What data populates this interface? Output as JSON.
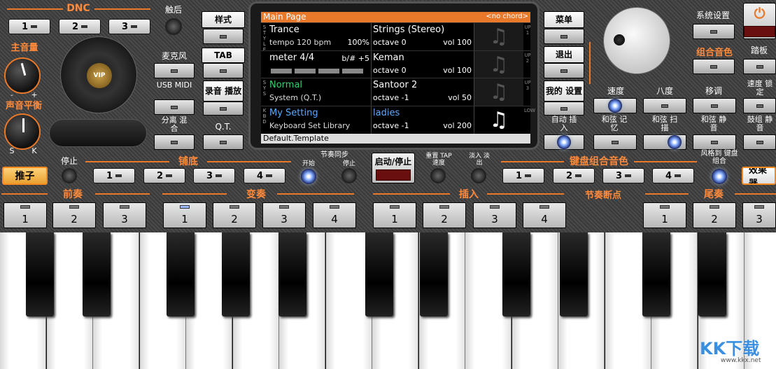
{
  "dnc": {
    "title": "DNC",
    "b1": "1",
    "b2": "2",
    "b3": "3",
    "touch": "触后"
  },
  "left": {
    "master": "主音量",
    "balance": "声音平衡",
    "minus": "-",
    "plus": "+",
    "s": "S",
    "k": "K",
    "vip": "VIP",
    "mic": "麦克风",
    "usb": "USB MIDI",
    "split": "分离 混合",
    "push": "推子"
  },
  "mid": {
    "style": "样式",
    "tab": "TAB",
    "rec": "录音 播放",
    "qt": "Q.T."
  },
  "lcd": {
    "header": "Main Page",
    "chord": "<no chord>",
    "footer": "Default.Template",
    "rows": [
      {
        "side": "S T Y L E",
        "l1": "Trance",
        "l1color": "#ffffff",
        "l2": "tempo 120 bpm",
        "l2r": "100%",
        "r1": "Strings (Stereo)",
        "r1color": "#ffffff",
        "r2": "octave  0",
        "vol": "vol 100",
        "tag": "UP 1"
      },
      {
        "side": "",
        "l1": "meter 4/4",
        "l1color": "#ffffff",
        "l2": "",
        "l2r": "b/# +5",
        "r1": "Keman",
        "r1color": "#ffffff",
        "r2": "octave  0",
        "vol": "vol 100",
        "tag": "UP 2"
      },
      {
        "side": "S Y S",
        "l1": "Normal",
        "l1color": "#36d16a",
        "l2": "System (Q.T.)",
        "l2r": "",
        "r1": "Santoor 2",
        "r1color": "#ffffff",
        "r2": "octave -1",
        "vol": "vol 50",
        "tag": "UP 3"
      },
      {
        "side": "K B D",
        "l1": "My Setting",
        "l1color": "#5aa9ff",
        "l2": "Keyboard Set Library",
        "l2r": "",
        "r1": "ladies",
        "r1color": "#5aa9ff",
        "r2": "octave -1",
        "vol": "vol 200",
        "tag": "LOW"
      }
    ]
  },
  "right": {
    "menu": "菜单",
    "exit": "退出",
    "mysetting": "我的 设置",
    "autofill": "自动 插入",
    "sys": "系统设置",
    "power": "⏻",
    "combo": "组合音色",
    "pedal": "踏板",
    "speed": "速度",
    "octave": "八度",
    "transpose": "移调",
    "speedlock": "速度 锁定",
    "chordmem": "和弦 记忆",
    "chordscan": "和弦 扫描",
    "chordmute": "和弦 静音",
    "drummute": "鼓组 静音"
  },
  "row2": {
    "stop": "停止",
    "base": "铺底",
    "b1": "1",
    "b2": "2",
    "b3": "3",
    "b4": "4",
    "sync": "节奏同步",
    "start": "开始",
    "stop2": "停止",
    "startstop": "启动/停止",
    "tap": "重置 TAP 速度",
    "fade": "淡入 淡出",
    "kbcombo": "键盘组合音色",
    "k1": "1",
    "k2": "2",
    "k3": "3",
    "k4": "4",
    "styletokb": "风格到 键盘组合",
    "effects": "效果器"
  },
  "row3": {
    "intro": "前奏",
    "variation": "变奏",
    "fill": "插入",
    "break": "节奏断点",
    "ending": "尾奏",
    "buttons": [
      "1",
      "2",
      "3",
      "1",
      "2",
      "3",
      "4",
      "1",
      "2",
      "3",
      "4",
      "1",
      "2",
      "3"
    ]
  },
  "watermark": {
    "text": "KK下载",
    "url": "www.kkx.net"
  }
}
